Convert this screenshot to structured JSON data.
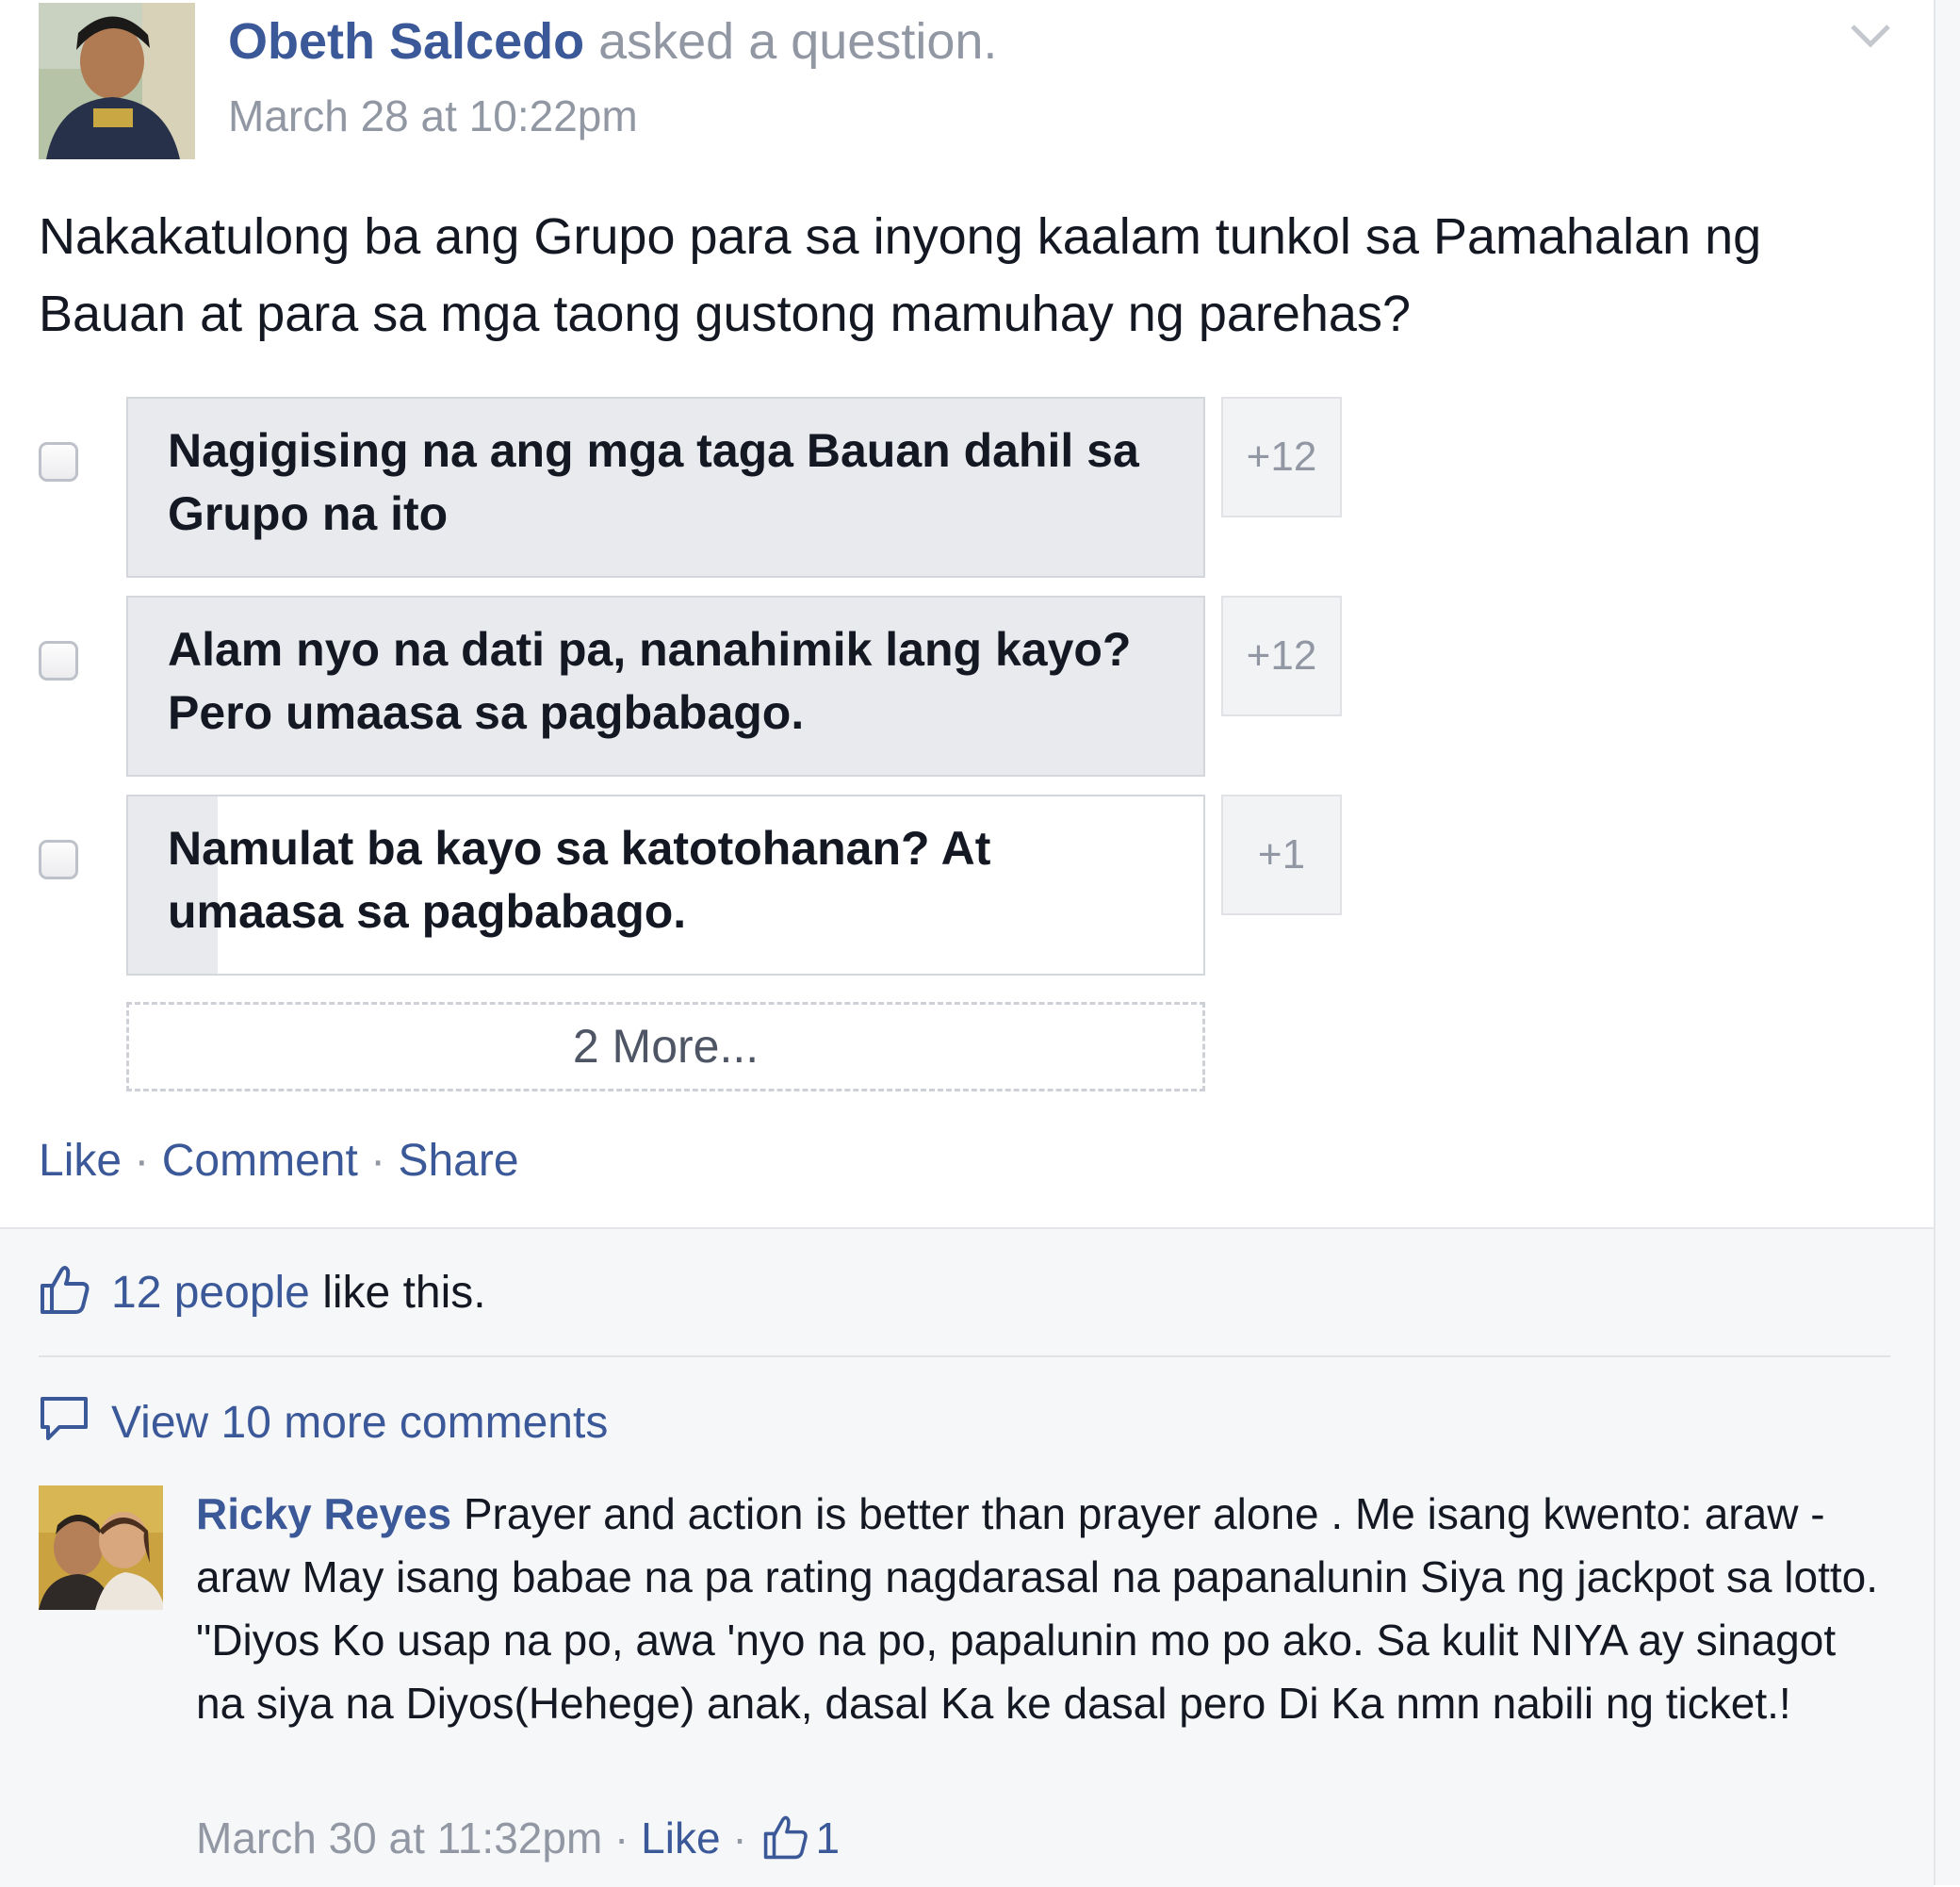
{
  "post": {
    "author": "Obeth Salcedo",
    "action": " asked a question.",
    "timestamp": "March 28 at 10:22pm",
    "question": "Nakakatulong ba ang Grupo para sa inyong kaalam tunkol sa Pamahalan ng Bauan at para sa mga taong gustong mamuhay ng parehas?",
    "options": [
      {
        "text": "Nagigising na ang mga taga Bauan dahil sa Grupo na ito",
        "votes": "+12",
        "vote_count": 12,
        "checked": false
      },
      {
        "text": "Alam nyo na dati pa, nanahimik lang kayo? Pero umaasa sa pagbabago.",
        "votes": "+12",
        "vote_count": 12,
        "checked": false
      },
      {
        "text": "Namulat ba kayo sa katotohanan? At umaasa sa pagbabago.",
        "votes": "+1",
        "vote_count": 1,
        "checked": false
      }
    ],
    "more_options": "2 More...",
    "actions": {
      "like": "Like",
      "comment": "Comment",
      "share": "Share",
      "separator": "·"
    }
  },
  "ufi": {
    "likes_people": "12 people",
    "likes_suffix": " like this.",
    "view_more": "View 10 more comments",
    "comment": {
      "author": "Ricky Reyes",
      "text": " Prayer and action is better than prayer alone . Me isang kwento: araw - araw May isang babae na pa rating nagdarasal na papanalunin Siya ng jackpot sa lotto. \"Diyos Ko usap na po, awa 'nyo na po, papalunin mo po ako. Sa kulit NIYA ay sinagot na siya na Diyos(Hehege) anak, dasal Ka ke dasal pero Di Ka nmn nabili ng ticket.!",
      "time": "March 30 at 11:32pm",
      "separator": " · ",
      "like": "Like",
      "like_count": "1"
    }
  },
  "icons": {
    "chevron": "chevron-down-icon",
    "like": "thumbs-up-icon",
    "comment": "speech-bubble-icon"
  },
  "colors": {
    "link": "#3b5998",
    "muted": "#9197a3",
    "poll_fill": "#e9eaed",
    "ufi_background": "#f6f7f9"
  }
}
